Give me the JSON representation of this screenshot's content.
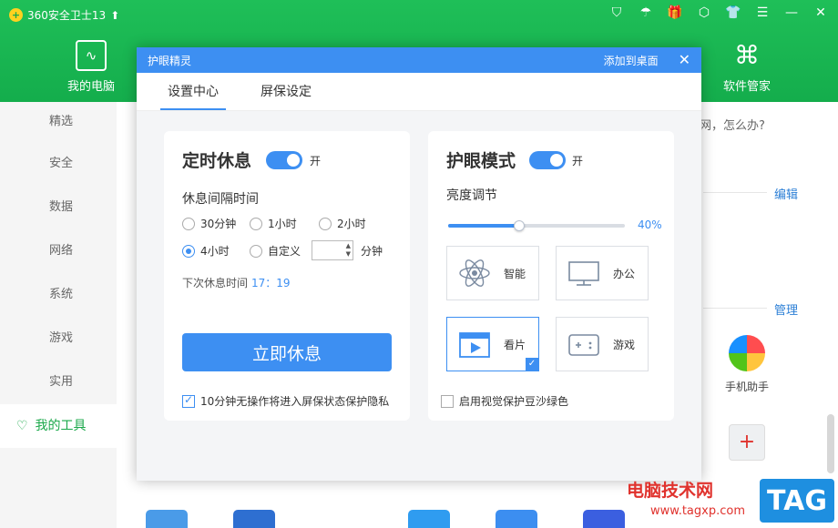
{
  "app": {
    "title": "360安全卫士13"
  },
  "nav": {
    "my_pc": "我的电脑",
    "software_manager": "软件管家"
  },
  "sidebar": {
    "items": [
      "精选",
      "安全",
      "数据",
      "网络",
      "系统",
      "游戏",
      "实用"
    ],
    "active": "我的工具"
  },
  "background": {
    "question": "网，怎么办?",
    "edit_link": "编辑",
    "manage_link": "管理",
    "tool_phone": "手机助手"
  },
  "dialog": {
    "title": "护眼精灵",
    "pin_label": "添加到桌面",
    "tabs": [
      "设置中心",
      "屏保设定"
    ],
    "rest": {
      "title": "定时休息",
      "toggle_label": "开",
      "interval_label": "休息间隔时间",
      "options": [
        "30分钟",
        "1小时",
        "2小时",
        "4小时",
        "自定义"
      ],
      "selected_option": "4小时",
      "unit_label": "分钟",
      "next_label": "下次休息时间",
      "next_time": "17：19",
      "button_label": "立即休息",
      "privacy_checkbox": "10分钟无操作将进入屏保状态保护隐私",
      "privacy_checked": true
    },
    "eye": {
      "title": "护眼模式",
      "toggle_label": "开",
      "brightness_label": "亮度调节",
      "brightness_value": 40,
      "brightness_text": "40%",
      "modes": [
        "智能",
        "办公",
        "看片",
        "游戏"
      ],
      "selected_mode": "看片",
      "green_checkbox": "启用视觉保护豆沙绿色",
      "green_checked": false
    }
  },
  "watermark": {
    "text": "电脑技术网",
    "url": "www.tagxp.com",
    "tag": "TAG"
  },
  "colors": {
    "brand_green": "#1aa84a",
    "accent_blue": "#3d8ff2",
    "watermark_red": "#e0322d"
  }
}
